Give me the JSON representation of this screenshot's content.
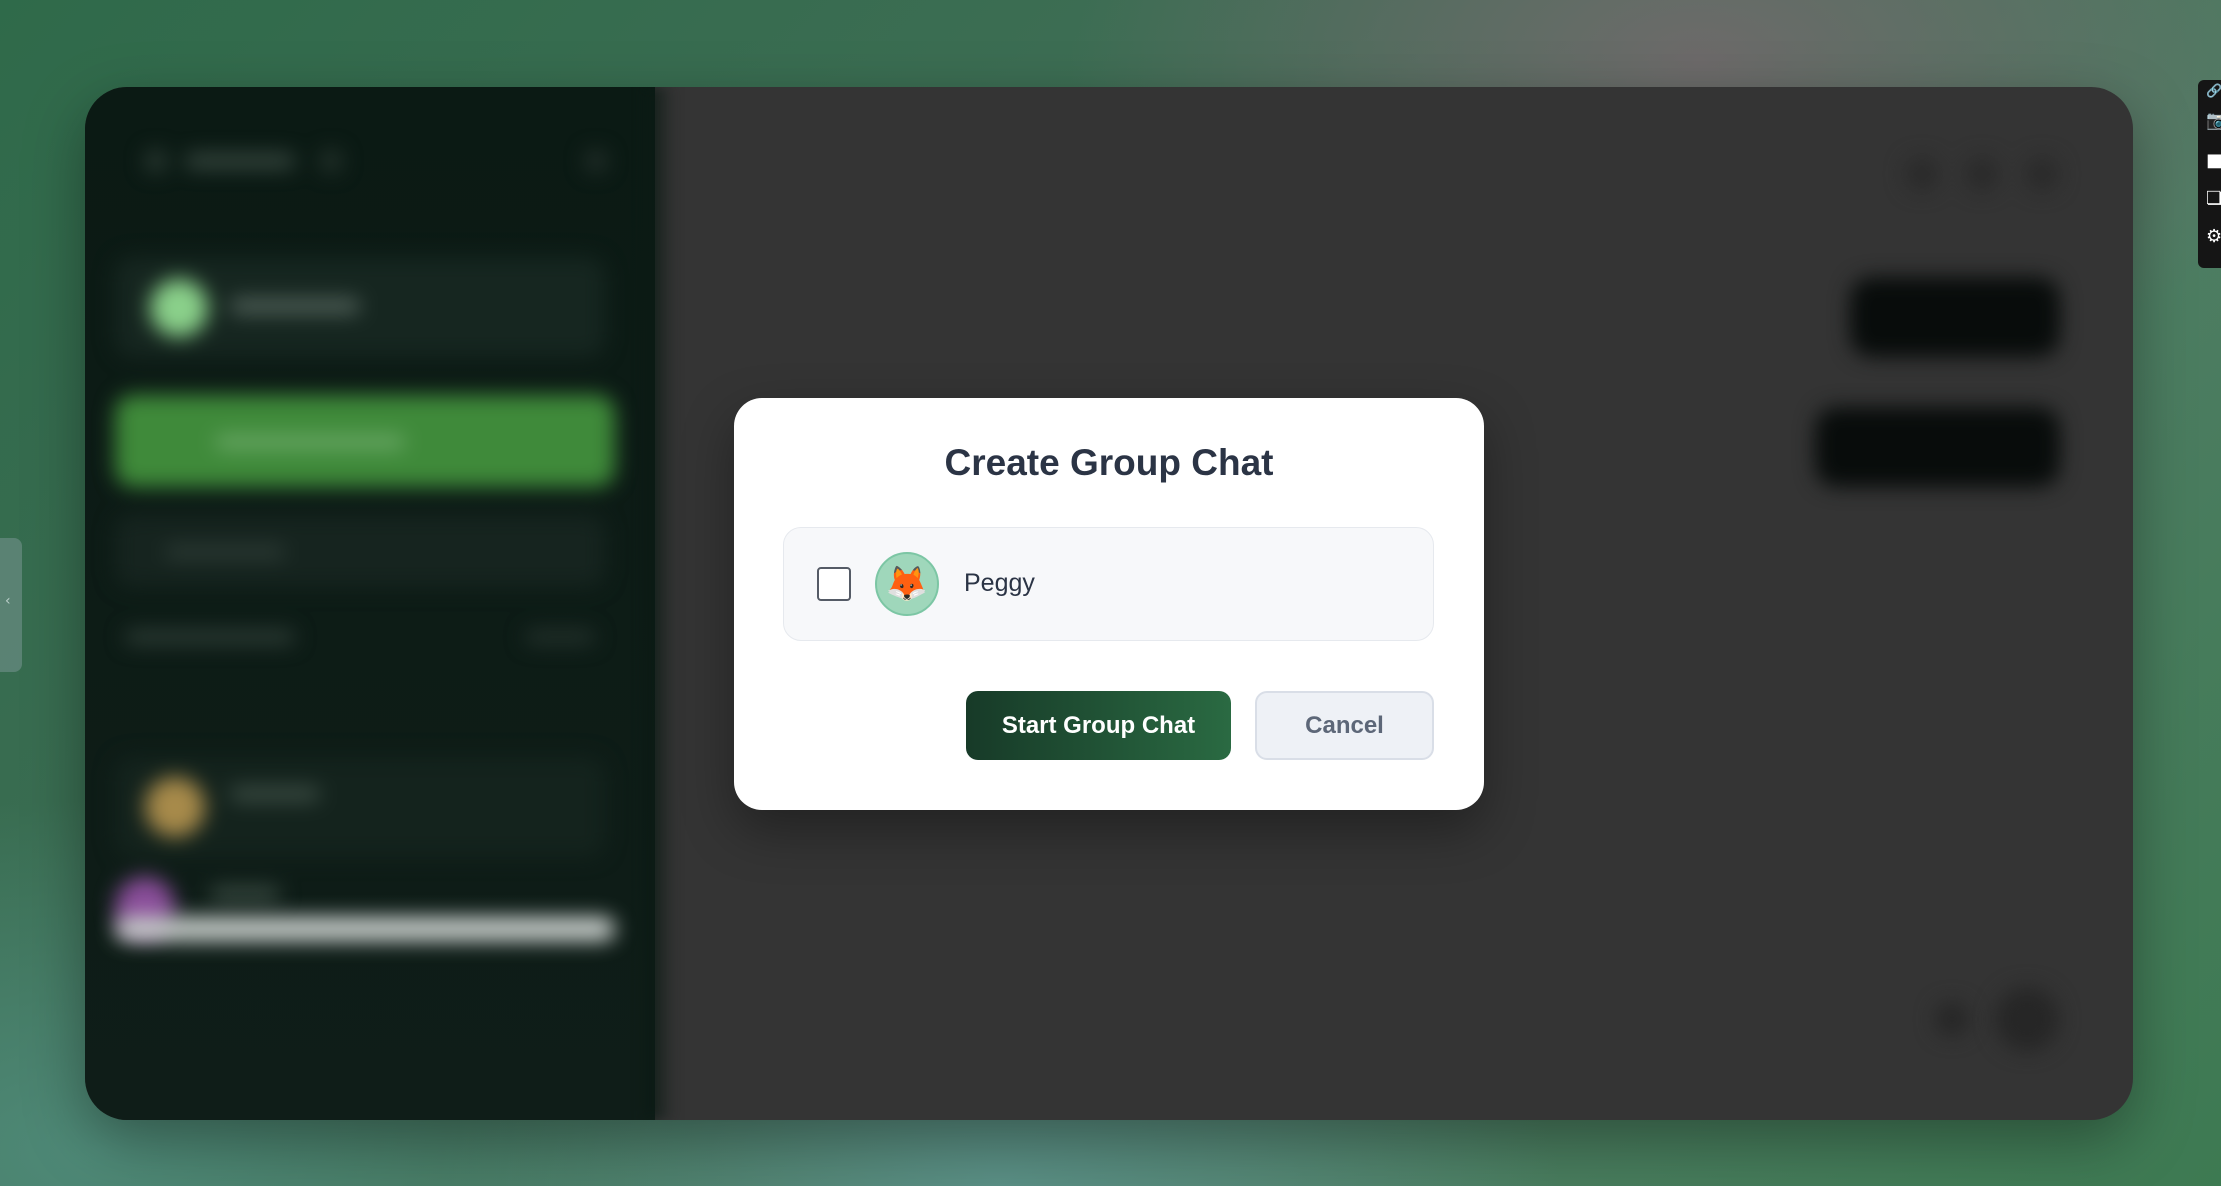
{
  "modal": {
    "title": "Create Group Chat",
    "users": [
      {
        "name": "Peggy",
        "avatar_icon": "fox-emoji",
        "avatar_glyph": "🦊",
        "checked": false
      }
    ],
    "start_label": "Start Group Chat",
    "cancel_label": "Cancel"
  },
  "colors": {
    "primary_button": "#1f4d33",
    "avatar_bg": "#9fd7bb",
    "title_text": "#2b3445"
  }
}
